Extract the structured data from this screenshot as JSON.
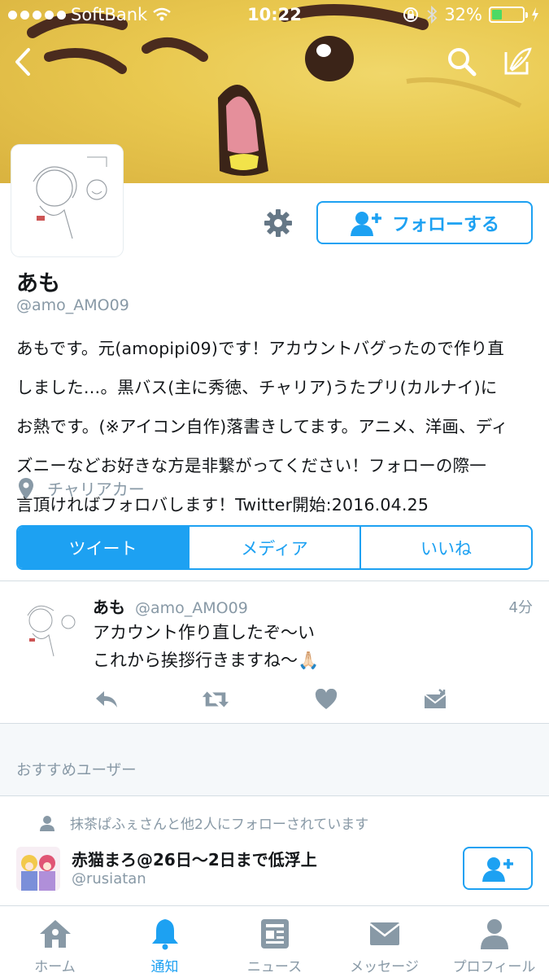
{
  "status_bar": {
    "carrier": "SoftBank",
    "time": "10:22",
    "battery": "32%",
    "battery_level": 0.32
  },
  "profile": {
    "display_name": "あも",
    "handle": "@amo_AMO09",
    "follow_label": "フォローする",
    "bio_lines": [
      "あもです。元(amopipi09)です！アカウントバグったので作り直",
      "しました…。黒バス(主に秀徳、チャリア)うたプリ(カルナイ)に",
      "お熱です。(※アイコン自作)落書きしてます。アニメ、洋画、ディ",
      "ズニーなどお好きな方是非繋がってください！フォローの際一",
      "言頂ければフォロバします！Twitter開始:2016.04.25"
    ],
    "location": "チャリアカー"
  },
  "tabs": [
    {
      "label": "ツイート",
      "active": true
    },
    {
      "label": "メディア",
      "active": false
    },
    {
      "label": "いいね",
      "active": false
    }
  ],
  "tweet": {
    "name": "あも",
    "handle": "@amo_AMO09",
    "time": "4分",
    "line1": "アカウント作り直したぞ〜い",
    "line2": "これから挨拶行きますね〜🙏🏻"
  },
  "recommended": {
    "title": "おすすめユーザー",
    "context": "抹茶ぱふぇさんと他2人にフォローされています",
    "name": "赤猫まろ@26日〜2日まで低浮上",
    "handle": "@rusiatan"
  },
  "tabbar": [
    {
      "label": "ホーム",
      "icon": "home-icon",
      "active": false
    },
    {
      "label": "通知",
      "icon": "bell-icon",
      "active": true
    },
    {
      "label": "ニュース",
      "icon": "news-icon",
      "active": false
    },
    {
      "label": "メッセージ",
      "icon": "envelope-icon",
      "active": false
    },
    {
      "label": "プロフィール",
      "icon": "person-icon",
      "active": false
    }
  ],
  "colors": {
    "accent": "#1da1f2",
    "muted": "#8899a6",
    "banner": "#e9c84f"
  }
}
